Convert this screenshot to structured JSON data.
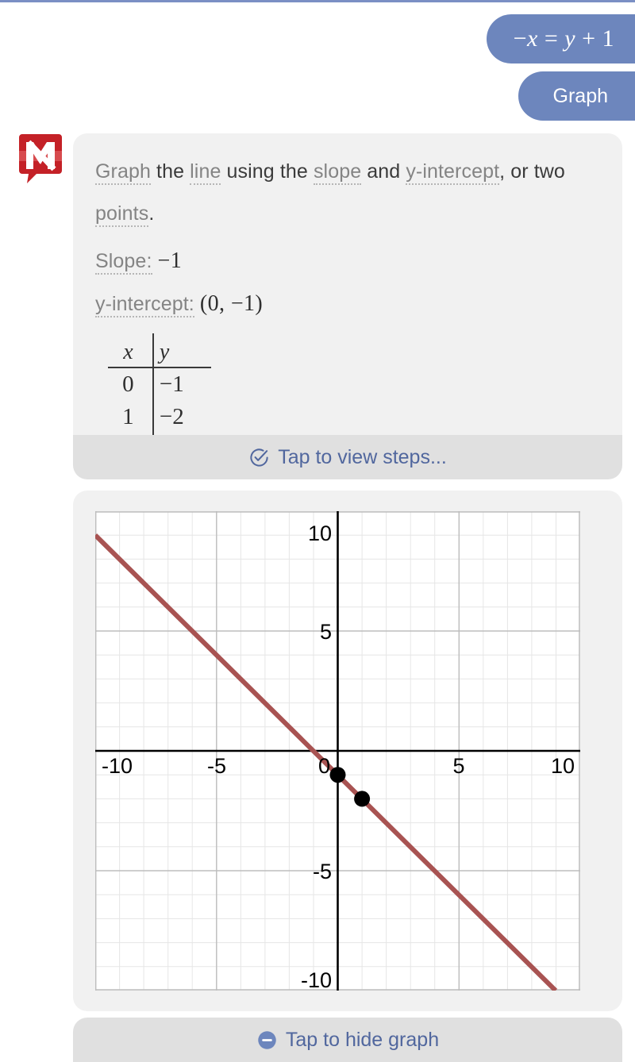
{
  "header": {
    "query_bubble": {
      "text": "−x = y + 1",
      "parts": [
        "−",
        "x",
        " = ",
        "y",
        " + 1"
      ]
    },
    "action_bubble": {
      "label": "Graph"
    }
  },
  "logo": {
    "name": "mathway-logo",
    "letter": "M",
    "color": "#c42127"
  },
  "answer": {
    "instruction": {
      "seg1": "Graph",
      "seg2": "the",
      "seg3": "line",
      "seg4": "using the",
      "seg5": "slope",
      "seg6": "and",
      "seg7": "y-intercept",
      "seg8": ", or two",
      "seg9": "points",
      "seg10": "."
    },
    "slope": {
      "label": "Slope:",
      "value": "−1"
    },
    "y_intercept": {
      "label": "y-intercept:",
      "value": "(0, −1)"
    },
    "table": {
      "headers": [
        "x",
        "y"
      ],
      "rows": [
        {
          "x": "0",
          "y": "−1"
        },
        {
          "x": "1",
          "y": "−2"
        }
      ]
    }
  },
  "tap_steps": {
    "label": "Tap to view steps...",
    "icon": "check-circle-icon",
    "color": "#51679e"
  },
  "tap_hide": {
    "label": "Tap to hide graph",
    "icon": "minus-circle-icon",
    "color": "#51679e"
  },
  "chart_data": {
    "type": "line",
    "title": "",
    "xlabel": "",
    "ylabel": "",
    "xlim": [
      -10,
      10
    ],
    "ylim": [
      -10,
      10
    ],
    "grid": true,
    "legend": "none",
    "x_ticks": [
      -10,
      -5,
      0,
      5,
      10
    ],
    "x_tick_labels": [
      "-10",
      "-5",
      "0",
      "5",
      "10"
    ],
    "y_ticks": [
      10,
      5,
      -5,
      -10
    ],
    "y_tick_labels": [
      "10",
      "5",
      "-5",
      "-10"
    ],
    "series": [
      {
        "name": "y = -x - 1",
        "color": "#a85352",
        "slope": -1,
        "intercept": -1,
        "x": [
          -10,
          10
        ],
        "values": [
          9,
          -11
        ]
      }
    ],
    "points": [
      {
        "x": 0,
        "y": -1,
        "color": "#000000"
      },
      {
        "x": 1,
        "y": -2,
        "color": "#000000"
      }
    ],
    "axis_color": "#000000",
    "grid_color": "#c9c9c9",
    "minor_grid_color": "#e4e4e4"
  }
}
